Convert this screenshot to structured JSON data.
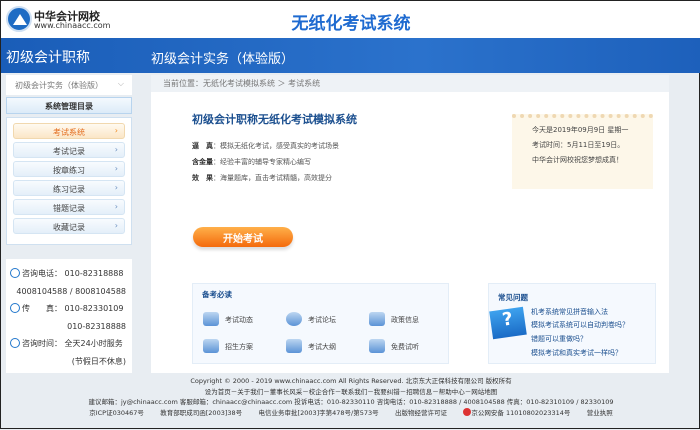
{
  "header": {
    "logo_name": "中华会计网校",
    "logo_url": "www.chinaacc.com",
    "title": "无纸化考试系统"
  },
  "bluebar": {
    "left": "初级会计职称",
    "right": "初级会计实务（体验版）"
  },
  "sidebar": {
    "select": "初级会计实务（体验版）",
    "menu_title": "系统管理目录",
    "items": [
      {
        "label": "考试系统"
      },
      {
        "label": "考试记录"
      },
      {
        "label": "按章练习"
      },
      {
        "label": "练习记录"
      },
      {
        "label": "错题记录"
      },
      {
        "label": "收藏记录"
      }
    ],
    "contact": {
      "phone_label": "咨询电话：",
      "phone1": "010-82318888",
      "phone2": "4008104588 / 8008104588",
      "fax_label": "传　　真：",
      "fax1": "010-82330109",
      "fax2": "010-82318888",
      "time_label": "咨询时间：",
      "time": "全天24小时服务",
      "time_note": "(节假日不休息)"
    }
  },
  "main": {
    "breadcrumb": "当前位置：无纸化考试模拟系统 ＞ 考试系统",
    "heading": "初级会计职称无纸化考试模拟系统",
    "features": [
      {
        "k": "逼　真",
        "v": "：模拟无纸化考试，感受真实的考试场景"
      },
      {
        "k": "含金量",
        "v": "：经验丰富的辅导专家精心编写"
      },
      {
        "k": "效　果",
        "v": "：海量题库，直击考试精髓，高效提分"
      }
    ],
    "start_button": "开始考试",
    "notice": [
      "今天是2019年09月9日 星期一",
      "考试时间：5月11日至19日。",
      "中华会计网校祝您梦想成真！"
    ],
    "guide": {
      "title": "备考必读",
      "items": [
        "考试动态",
        "考试论坛",
        "政策信息",
        "招生方案",
        "考试大纲",
        "免费试听"
      ]
    },
    "faq": {
      "title": "常见问题",
      "items": [
        "机考系统常见拼音输入法",
        "模拟考试系统可以自动判卷吗？",
        "错题可以重做吗？",
        "模拟考试和真实考试一样吗？"
      ]
    }
  },
  "footer": {
    "line1": "Copyright © 2000 - 2019 www.chinaacc.com All Rights Reserved.  北京东大正保科技有限公司 版权所有",
    "line2": "设为首页－关于我们－董事长风采－校企合作－联系我们－我要纠错－招聘信息－帮助中心－网站地图",
    "line3": "建议邮箱：jy@chinaacc.com  客服邮箱：chinaacc@chinaacc.com  投诉电话：010-82330110  咨询电话：010-82318888 / 4008104588  传真：010-82310109 / 82330109",
    "line4": [
      "京ICP证030467号",
      "教育部职成司函[2003]38号",
      "电信业务审批[2003]字第478号/第573号",
      "出版物经营许可证",
      "京公网安备 11010802023314号",
      "营业执照"
    ]
  }
}
